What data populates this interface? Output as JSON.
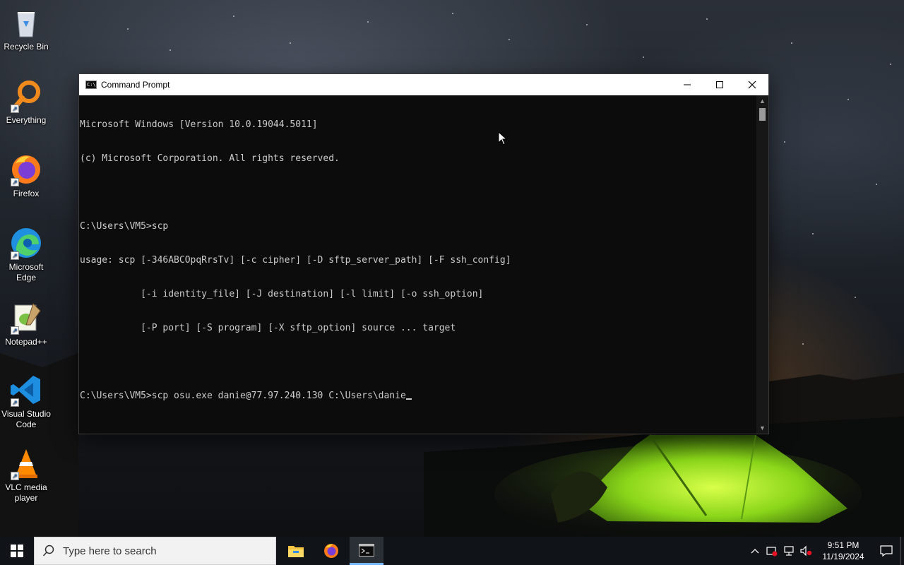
{
  "desktop": {
    "icons": [
      {
        "label": "Recycle Bin"
      },
      {
        "label": "Everything"
      },
      {
        "label": "Firefox"
      },
      {
        "label": "Microsoft Edge"
      },
      {
        "label": "Notepad++"
      },
      {
        "label": "Visual Studio Code"
      },
      {
        "label": "VLC media player"
      }
    ]
  },
  "window": {
    "title": "Command Prompt",
    "controls": {
      "minimize": "—",
      "maximize": "☐",
      "close": "✕"
    },
    "console_lines": [
      "Microsoft Windows [Version 10.0.19044.5011]",
      "(c) Microsoft Corporation. All rights reserved.",
      "",
      "C:\\Users\\VM5>scp",
      "usage: scp [-346ABCOpqRrsTv] [-c cipher] [-D sftp_server_path] [-F ssh_config]",
      "           [-i identity_file] [-J destination] [-l limit] [-o ssh_option]",
      "           [-P port] [-S program] [-X sftp_option] source ... target",
      "",
      "C:\\Users\\VM5>scp osu.exe danie@77.97.240.130 C:\\Users\\danie"
    ]
  },
  "taskbar": {
    "search_placeholder": "Type here to search",
    "pinned": [
      "File Explorer",
      "Firefox",
      "Command Prompt"
    ],
    "active_app": "Command Prompt",
    "clock": {
      "time": "9:51 PM",
      "date": "11/19/2024"
    }
  },
  "colors": {
    "console_bg": "#0c0c0c",
    "console_fg": "#cccccc",
    "taskbar_bg": "#101317",
    "accent": "#77b7ff"
  }
}
